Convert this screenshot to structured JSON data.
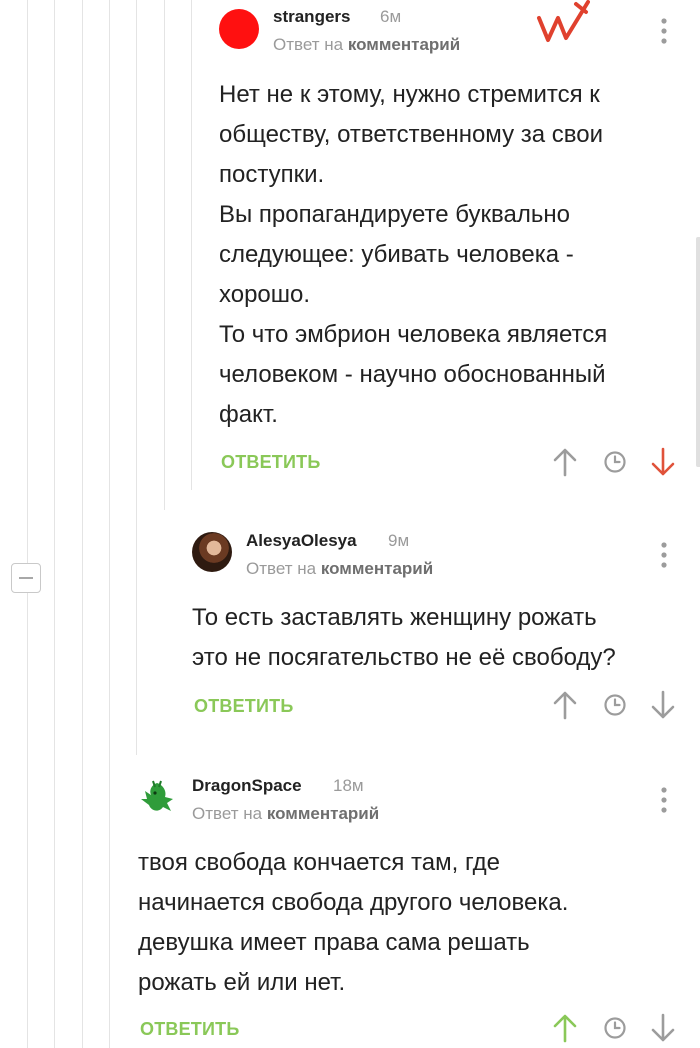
{
  "comments": [
    {
      "username": "strangers",
      "time": "6м",
      "reply_prefix": "Ответ на",
      "reply_target": "комментарий",
      "lines": [
        "Нет не к этому, нужно стремится к",
        "обществу, ответственному за свои",
        "поступки.",
        "Вы пропагандируете буквально",
        "следующее: убивать человека -",
        "хорошо.",
        "То что эмбрион человека является",
        "человеком - научно обоснованный",
        "факт."
      ],
      "reply_label": "ОТВЕТИТЬ"
    },
    {
      "username": "AlesyaOlesya",
      "time": "9м",
      "reply_prefix": "Ответ на",
      "reply_target": "комментарий",
      "lines": [
        "То есть заставлять женщину рожать",
        "это не посягательство не её свободу?"
      ],
      "reply_label": "ОТВЕТИТЬ"
    },
    {
      "username": "DragonSpace",
      "time": "18м",
      "reply_prefix": "Ответ на",
      "reply_target": "комментарий",
      "lines": [
        "твоя свобода кончается там, где",
        "начинается свобода другого человека.",
        "девушка имеет права сама решать",
        "рожать ей или нет."
      ],
      "reply_label": "ОТВЕТИТЬ"
    }
  ],
  "colors": {
    "reply_green": "#8ac858",
    "upvote_active": "#8ac858",
    "downvote_active": "#e0523a",
    "icon_gray": "#9c9c9c",
    "avatar_red": "#ff1010"
  },
  "icons": {
    "upvote": "arrow-up-icon",
    "downvote": "arrow-down-icon",
    "save": "clock-icon",
    "menu": "kebab-menu-icon",
    "collapse": "minus-icon"
  }
}
